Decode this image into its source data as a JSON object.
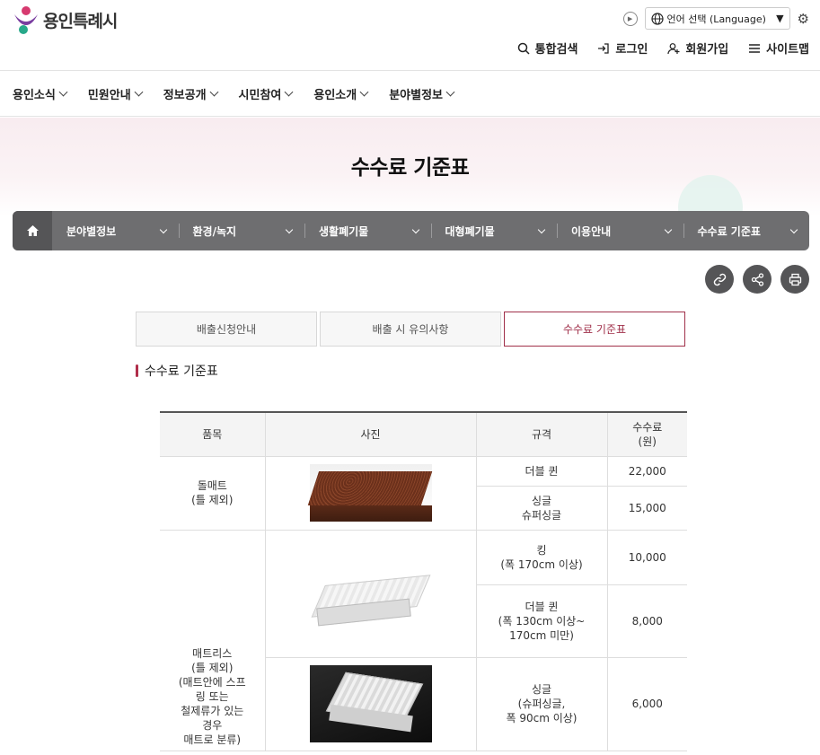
{
  "header": {
    "logo_text": "용인특례시",
    "language_label": "언어 선택 (Language)",
    "utility_links": [
      {
        "label": "통합검색",
        "icon": "search-icon"
      },
      {
        "label": "로그인",
        "icon": "login-icon"
      },
      {
        "label": "회원가입",
        "icon": "user-add-icon"
      },
      {
        "label": "사이트맵",
        "icon": "menu-icon"
      }
    ]
  },
  "nav": {
    "items": [
      "용인소식",
      "민원안내",
      "정보공개",
      "시민참여",
      "용인소개",
      "분야별정보"
    ]
  },
  "page": {
    "title": "수수료 기준표"
  },
  "breadcrumb": {
    "items": [
      "분야별정보",
      "환경/녹지",
      "생활폐기물",
      "대형폐기물",
      "이용안내",
      "수수료 기준표"
    ]
  },
  "tools": [
    "link-icon",
    "share-icon",
    "print-icon"
  ],
  "tabs": [
    {
      "label": "배출신청안내",
      "active": false
    },
    {
      "label": "배출 시 유의사항",
      "active": false
    },
    {
      "label": "수수료 기준표",
      "active": true
    }
  ],
  "section_title": "수수료 기준표",
  "table": {
    "headers": [
      "품목",
      "사진",
      "규격",
      "수수료\n(원)"
    ],
    "groups": [
      {
        "item": "돌매트\n(틀 제외)",
        "rows": [
          {
            "spec": "더블 퀸",
            "fee": "22,000"
          },
          {
            "spec": "싱글\n슈퍼싱글",
            "fee": "15,000"
          }
        ]
      },
      {
        "item": "매트리스\n(틀 제외)\n(매트안에 스프\n링 또는\n철제류가 있는\n경우\n매트로 분류)",
        "rows": [
          {
            "spec": "킹\n(폭 170cm 이상)",
            "fee": "10,000"
          },
          {
            "spec": "더블 퀸\n(폭 130cm 이상~\n170cm 미만)",
            "fee": "8,000"
          },
          {
            "spec": "싱글\n(슈퍼싱글,\n폭 90cm 이상)",
            "fee": "6,000"
          }
        ]
      }
    ]
  },
  "colors": {
    "accent": "#a0304a",
    "breadcrumb_bg": "#6e6e70",
    "hero_bg": "#f8ecf0"
  }
}
